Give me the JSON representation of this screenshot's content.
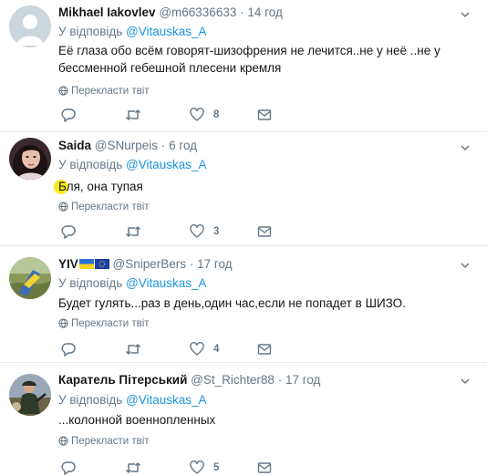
{
  "tweets": [
    {
      "name": "Mikhael Iakovlev",
      "handle": "@m66336633",
      "dot": "·",
      "time": "14 год",
      "reply_prefix": "У відповідь",
      "reply_to": "@Vitauskas_A",
      "text": "Её глаза обо всём говорят-шизофрения не лечится..не у неё ..не у бессменной гебешной плесени кремля",
      "translate": "Перекласти твіт",
      "like_count": "8"
    },
    {
      "name": "Saida",
      "handle": "@SNurpeis",
      "dot": "·",
      "time": "6 год",
      "reply_prefix": "У відповідь",
      "reply_to": "@Vitauskas_A",
      "text": "Бля, она тупая",
      "translate": "Перекласти твіт",
      "like_count": "3"
    },
    {
      "name": "YIV",
      "handle": "@SniperBers",
      "dot": "·",
      "time": "17 год",
      "reply_prefix": "У відповідь",
      "reply_to": "@Vitauskas_A",
      "text": "Будет гулять...раз в день,один час,если не попадет в ШИЗО.",
      "translate": "Перекласти твіт",
      "like_count": "4"
    },
    {
      "name": "Каратель Пітерський",
      "handle": "@St_Richter88",
      "dot": "·",
      "time": "17 год",
      "reply_prefix": "У відповідь",
      "reply_to": "@Vitauskas_A",
      "text": "...колонной военнопленных",
      "translate": "Перекласти твіт",
      "like_count": "5"
    }
  ],
  "colors": {
    "link": "#1b95e0",
    "muted": "#657786",
    "text": "#14171a",
    "divider": "#e6ecf0",
    "highlight": "#ffe600"
  },
  "icons": {
    "reply": "reply-icon",
    "retweet": "retweet-icon",
    "like": "heart-icon",
    "dm": "envelope-icon",
    "globe": "globe-icon",
    "caret": "chevron-down-icon"
  }
}
